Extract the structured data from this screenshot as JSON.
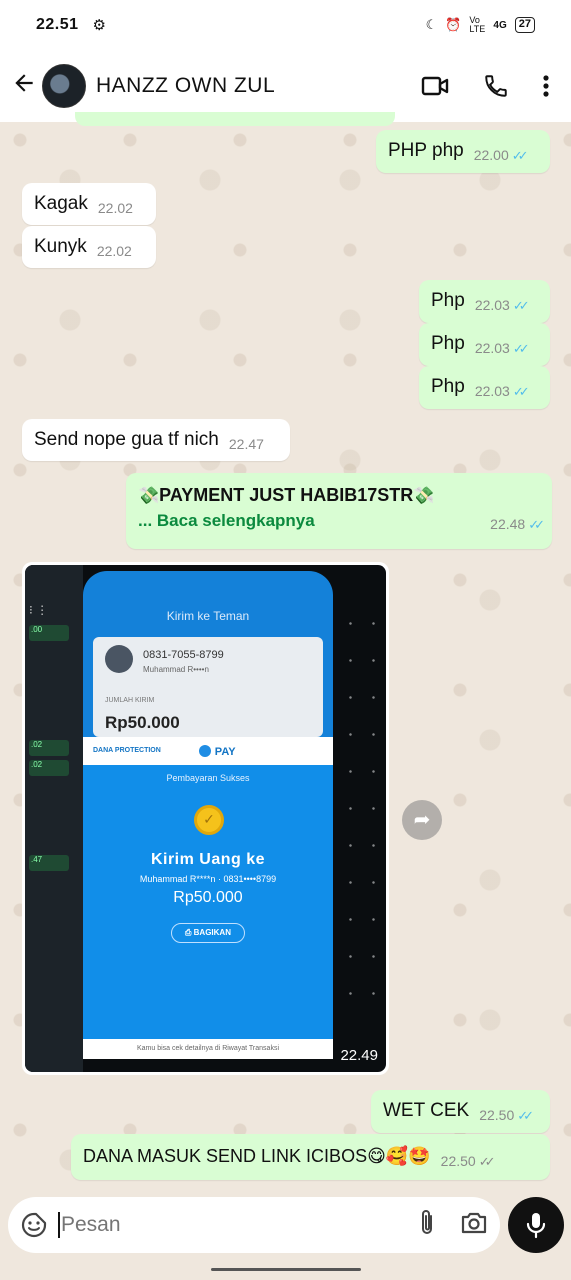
{
  "status_bar": {
    "time": "22.51",
    "network": "Vo LTE",
    "signal": "4G",
    "battery": "27"
  },
  "header": {
    "contact_name": "HANZZ OWN ZUL",
    "icons": [
      "back-arrow-icon",
      "video-call-icon",
      "phone-icon",
      "more-icon"
    ]
  },
  "messages": [
    {
      "dir": "out",
      "text": "PHP php",
      "time": "22.00",
      "status": "read"
    },
    {
      "dir": "in",
      "text": "Kagak",
      "time": "22.02"
    },
    {
      "dir": "in",
      "text": "Kunyk",
      "time": "22.02"
    },
    {
      "dir": "out",
      "text": "Php",
      "time": "22.03",
      "status": "read"
    },
    {
      "dir": "out",
      "text": "Php",
      "time": "22.03",
      "status": "read"
    },
    {
      "dir": "out",
      "text": "Php",
      "time": "22.03",
      "status": "read"
    },
    {
      "dir": "in",
      "text": "Send nope gua tf nich",
      "time": "22.47"
    },
    {
      "dir": "out",
      "text": "PAYMENT JUST HABIB17STR",
      "read_more": "... Baca selengkapnya",
      "emoji": "💸",
      "time": "22.48",
      "status": "read"
    },
    {
      "dir": "in",
      "type": "image",
      "time": "22.49"
    },
    {
      "dir": "out",
      "text": "WET CEK",
      "time": "22.50",
      "status": "read"
    },
    {
      "dir": "out",
      "text": "DANA MASUK SEND LINK ICIBOS😋🥰🤩",
      "time": "22.50",
      "status": "delivered"
    }
  ],
  "screenshot_image": {
    "title": "Kirim ke Teman",
    "phone": "0831-7055-8799",
    "name": "Muhammad R••••n",
    "amount_label": "JUMLAH KIRIM",
    "amount_top": "Rp50.000",
    "brand_left": "DANA PROTECTION",
    "brand_pay": "PAY",
    "status": "Pembayaran Sukses",
    "heading": "Kirim Uang ke",
    "recipient": "Muhammad R****n · 0831••••8799",
    "amount": "Rp50.000",
    "share_button": "BAGIKAN",
    "footer": "Kamu bisa cek detailnya di Riwayat Transaksi",
    "left_times": [
      ".00",
      ".02",
      ".02",
      ".47"
    ]
  },
  "input": {
    "placeholder": "Pesan"
  },
  "colors": {
    "outgoing_bubble": "#d9fdd3",
    "incoming_bubble": "#ffffff",
    "read_ticks": "#53bdeb",
    "wallpaper": "#efe7dd"
  }
}
